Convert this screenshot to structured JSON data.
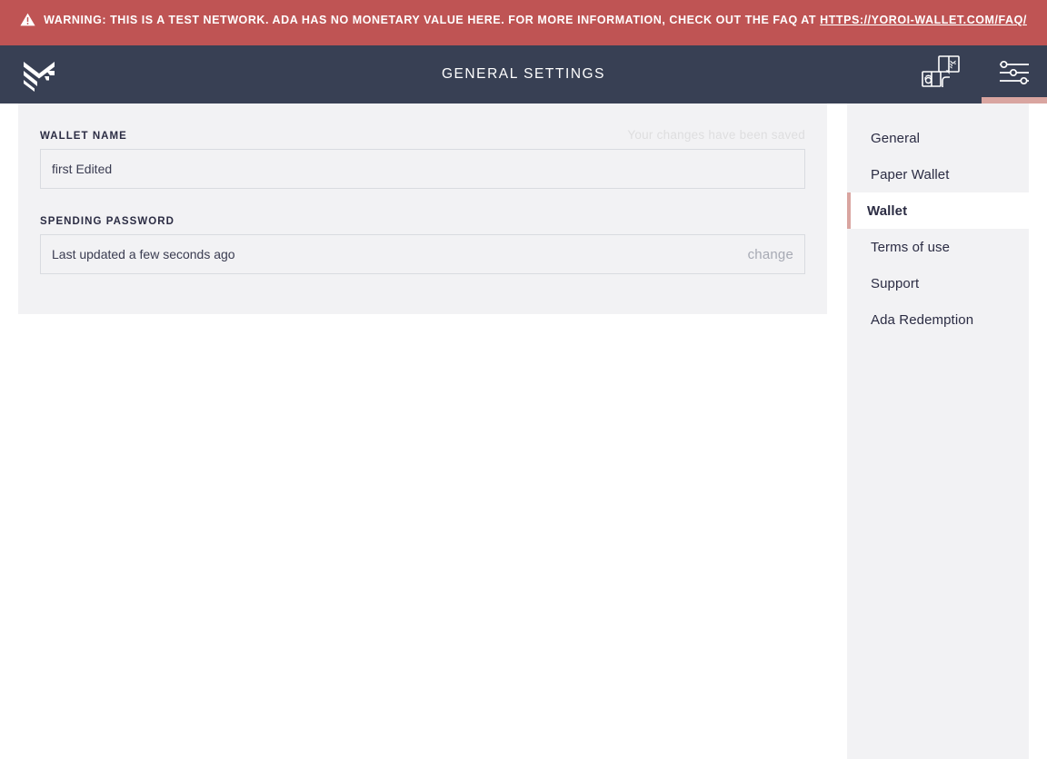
{
  "warning": {
    "icon": "warning-triangle-icon",
    "text_before_link": "WARNING: THIS IS A TEST NETWORK. ADA HAS NO MONETARY VALUE HERE. FOR MORE INFORMATION, CHECK OUT THE FAQ AT ",
    "link_text": "HTTPS://YOROI-WALLET.COM/FAQ/",
    "background_color": "#bf5454",
    "text_color": "#ffffff"
  },
  "topbar": {
    "logo": "yoroi-chevron-logo",
    "title": "GENERAL SETTINGS",
    "background_color": "#384054",
    "actions": [
      {
        "name": "wallet-transfer-icon",
        "label": "Transfer wallet",
        "active": false
      },
      {
        "name": "settings-sliders-icon",
        "label": "Settings",
        "active": true
      }
    ],
    "active_indicator_color": "#d9a5a0"
  },
  "settings": {
    "wallet_name": {
      "label": "WALLET NAME",
      "value": "first Edited",
      "placeholder": "Wallet name"
    },
    "saved_message": "Your changes have been saved",
    "spending_password": {
      "label": "SPENDING PASSWORD",
      "status": "Last updated a few seconds ago",
      "change_label": "change"
    }
  },
  "menu": {
    "items": [
      {
        "label": "General",
        "active": false
      },
      {
        "label": "Paper Wallet",
        "active": false
      },
      {
        "label": "Wallet",
        "active": true
      },
      {
        "label": "Terms of use",
        "active": false
      },
      {
        "label": "Support",
        "active": false
      },
      {
        "label": "Ada Redemption",
        "active": false
      }
    ],
    "active_accent_color": "#d9a5a0"
  }
}
